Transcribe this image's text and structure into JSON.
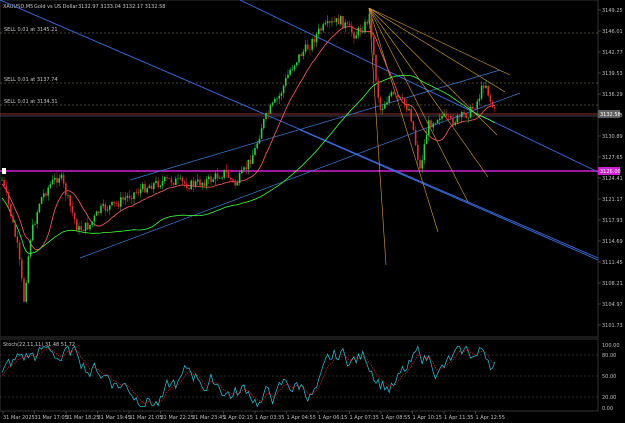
{
  "header": {
    "symbol_line": "XAUUSD,M5",
    "name_line": "Gold vs US Dollar",
    "ohlc_line": "3132.97 3133.04 3132.17 3132.58"
  },
  "orders": [
    {
      "text": "SELL 0.01 at 3145.21"
    },
    {
      "text": "SELL 0.01 at 3137.74"
    },
    {
      "text": "SELL 0.01 at 3134.31"
    }
  ],
  "price_tags": {
    "current": "3132.58",
    "magenta_line": "3126.00"
  },
  "oscillator": {
    "label": "Stoch(22,11,11) 31.48 51.72",
    "levels": [
      "100.00",
      "80.00",
      "50.00",
      "20.00",
      "0.00"
    ]
  },
  "price_axis": [
    "3149.25",
    "3146.01",
    "3142.77",
    "3139.53",
    "3136.29",
    "3134.13",
    "3130.89",
    "3127.65",
    "3124.41",
    "3121.17",
    "3117.93",
    "3114.69",
    "3111.45",
    "3108.21",
    "3104.97",
    "3101.73"
  ],
  "time_axis": [
    "31 Mar 2025",
    "31 Mar 17:05",
    "31 Mar 18:25",
    "31 Mar 19:45",
    "31 Mar 21:05",
    "31 Mar 22:25",
    "31 Mar 23:45",
    "1 Apr 02:15",
    "1 Apr 03:35",
    "1 Apr 04:55",
    "1 Apr 06:15",
    "1 Apr 07:35",
    "1 Apr 08:55",
    "1 Apr 10:15",
    "1 Apr 11:35",
    "1 Apr 12:55"
  ],
  "colors": {
    "background": "#000000",
    "bull": "#2ecc40",
    "bear": "#e03030",
    "trend": "#3f6ce0",
    "magenta": "#d020d0",
    "fan": "#d9a040",
    "ma_fast": "#ff6060",
    "ma_slow": "#40ff40",
    "stoch_main": "#30c8e0",
    "stoch_signal": "#e03030"
  }
}
